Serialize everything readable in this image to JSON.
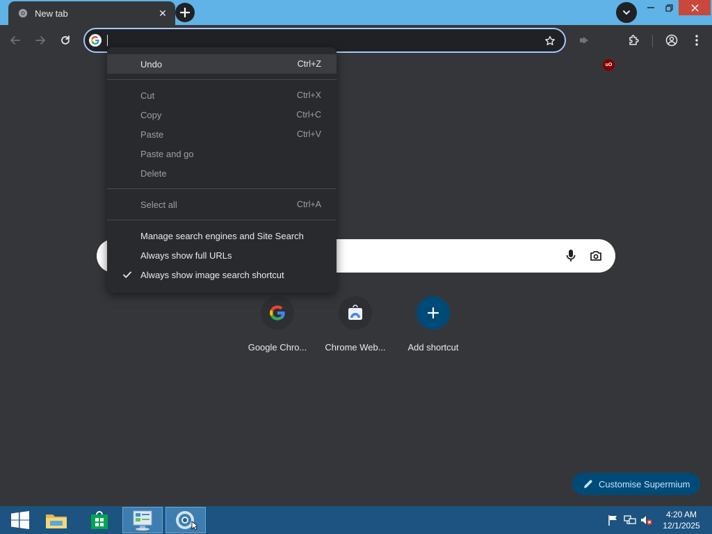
{
  "tab": {
    "title": "New tab",
    "close_glyph": "✕"
  },
  "omnibox": {
    "value": ""
  },
  "context_menu": {
    "items": [
      {
        "label": "Undo",
        "shortcut": "Ctrl+Z"
      },
      {
        "label": "Cut",
        "shortcut": "Ctrl+X"
      },
      {
        "label": "Copy",
        "shortcut": "Ctrl+C"
      },
      {
        "label": "Paste",
        "shortcut": "Ctrl+V"
      },
      {
        "label": "Paste and go",
        "shortcut": ""
      },
      {
        "label": "Delete",
        "shortcut": ""
      },
      {
        "label": "Select all",
        "shortcut": "Ctrl+A"
      },
      {
        "label": "Manage search engines and Site Search",
        "shortcut": ""
      },
      {
        "label": "Always show full URLs",
        "shortcut": ""
      },
      {
        "label": "Always show image search shortcut",
        "shortcut": "",
        "checked": true
      }
    ]
  },
  "shortcuts": [
    {
      "label": "Google Chro..."
    },
    {
      "label": "Chrome Web..."
    },
    {
      "label": "Add shortcut"
    }
  ],
  "customise": {
    "label": "Customise Supermium"
  },
  "extensions": {
    "ublock_badge": "uO"
  },
  "clock": {
    "time": "4:20 AM",
    "date": "12/1/2025"
  },
  "colors": {
    "titlebar": "#5fb3e6",
    "background": "#35363a",
    "omnibox_border": "#a8c7fa",
    "accent_button": "#004a77",
    "close_button": "#c9483b",
    "taskbar": "#1c5380"
  },
  "icons": {
    "back": "arrow-left-icon",
    "forward": "arrow-right-icon",
    "reload": "reload-icon",
    "star": "star-icon",
    "extensions": "puzzle-icon",
    "profile": "profile-icon",
    "menu": "kebab-menu-icon",
    "mic": "microphone-icon",
    "camera": "camera-icon",
    "check": "check-icon"
  }
}
